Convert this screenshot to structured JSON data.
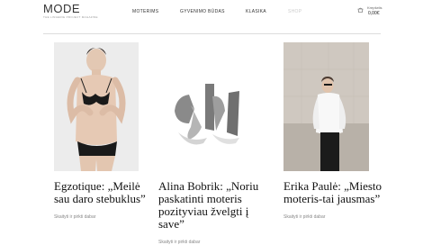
{
  "logo": {
    "main": "MODE",
    "sub": "THE LINGERIE PROJECT MAGAZINE"
  },
  "nav": {
    "items": [
      {
        "label": "MOTERIMS"
      },
      {
        "label": "GYVENIMO BŪDAS"
      },
      {
        "label": "KLASIKA"
      },
      {
        "label": "SHOP"
      }
    ]
  },
  "cart": {
    "label": "Krepšelis",
    "amount": "0,00€"
  },
  "articles": [
    {
      "title": "Egzotique: „Meilė sau daro stebuklus”",
      "link": "Skaityti ir pirkti dabar"
    },
    {
      "title": "Alina Bobrik: „Noriu paskatinti moteris pozityviau žvelgti į save”",
      "link": "Skaityti ir pirkti dabar"
    },
    {
      "title": "Erika Paulė: „Miesto moteris-tai jausmas”",
      "link": "Skaityti ir pirkti dabar"
    }
  ],
  "colors": {
    "text": "#222222",
    "muted": "#888888",
    "divider": "#dddddd",
    "background": "#ffffff"
  }
}
